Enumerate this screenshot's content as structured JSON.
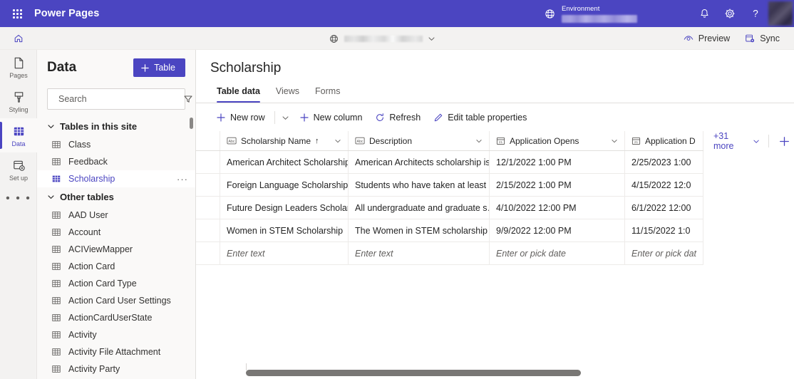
{
  "topbar": {
    "waffle_label": "App launcher",
    "brand": "Power Pages",
    "environment_label": "Environment",
    "environment_value": "",
    "notifications_label": "Notifications",
    "settings_label": "Settings",
    "help_label": "Help",
    "account_label": "Account manager"
  },
  "subbar": {
    "home_label": "Home",
    "site_name": "",
    "site_chevron": "chevron-down",
    "preview_label": "Preview",
    "sync_label": "Sync"
  },
  "rail": {
    "items": [
      {
        "label": "Pages",
        "icon": "page-icon",
        "active": false
      },
      {
        "label": "Styling",
        "icon": "brush-icon",
        "active": false
      },
      {
        "label": "Data",
        "icon": "data-icon",
        "active": true
      },
      {
        "label": "Set up",
        "icon": "setup-icon",
        "active": false
      }
    ],
    "more_label": "• • •"
  },
  "panel": {
    "title": "Data",
    "add_table_label": "Table",
    "search_placeholder": "Search",
    "search_value": "",
    "filter_label": "Filter",
    "groups": [
      {
        "label": "Tables in this site",
        "expanded": true,
        "items": [
          {
            "label": "Class",
            "selected": false
          },
          {
            "label": "Feedback",
            "selected": false
          },
          {
            "label": "Scholarship",
            "selected": true,
            "overflow": "···"
          }
        ]
      },
      {
        "label": "Other tables",
        "expanded": true,
        "items": [
          {
            "label": "AAD User",
            "selected": false
          },
          {
            "label": "Account",
            "selected": false
          },
          {
            "label": "ACIViewMapper",
            "selected": false
          },
          {
            "label": "Action Card",
            "selected": false
          },
          {
            "label": "Action Card Type",
            "selected": false
          },
          {
            "label": "Action Card User Settings",
            "selected": false
          },
          {
            "label": "ActionCardUserState",
            "selected": false
          },
          {
            "label": "Activity",
            "selected": false
          },
          {
            "label": "Activity File Attachment",
            "selected": false
          },
          {
            "label": "Activity Party",
            "selected": false
          }
        ]
      }
    ]
  },
  "main": {
    "title": "Scholarship",
    "tabs": [
      {
        "label": "Table data",
        "active": true
      },
      {
        "label": "Views",
        "active": false
      },
      {
        "label": "Forms",
        "active": false
      }
    ],
    "commands": [
      {
        "label": "New row",
        "icon": "plus-icon"
      },
      {
        "label": "New column",
        "icon": "plus-icon"
      },
      {
        "label": "Refresh",
        "icon": "refresh-icon"
      },
      {
        "label": "Edit table properties",
        "icon": "pencil-icon"
      }
    ],
    "new_row_caret": "chevron-down"
  },
  "grid": {
    "columns": [
      {
        "label": "Scholarship Name",
        "type_icon": "abc-icon",
        "sorted": true,
        "sort_dir": "↑"
      },
      {
        "label": "Description",
        "type_icon": "abc-icon",
        "sorted": false,
        "sort_dir": ""
      },
      {
        "label": "Application Opens",
        "type_icon": "calendar-icon",
        "sorted": false,
        "sort_dir": ""
      },
      {
        "label": "Application D",
        "type_icon": "calendar-icon",
        "sorted": false,
        "sort_dir": ""
      }
    ],
    "more_columns_label": "+31 more",
    "add_column_label": "Add column",
    "rows": [
      {
        "name": "American Architect Scholarship",
        "description": "American Architects scholarship is…",
        "opens": "12/1/2022 1:00 PM",
        "due": "2/25/2023 1:00"
      },
      {
        "name": "Foreign Language Scholarship",
        "description": "Students who have taken at least …",
        "opens": "2/15/2022 1:00 PM",
        "due": "4/15/2022 12:0"
      },
      {
        "name": "Future Design Leaders Scholarship",
        "description": "All undergraduate and graduate s…",
        "opens": "4/10/2022 12:00 PM",
        "due": "6/1/2022 12:00"
      },
      {
        "name": "Women in STEM Scholarship",
        "description": "The Women in STEM scholarship i…",
        "opens": "9/9/2022 12:00 PM",
        "due": "11/15/2022 1:0"
      }
    ],
    "new_row": {
      "name_placeholder": "Enter text",
      "description_placeholder": "Enter text",
      "opens_placeholder": "Enter or pick date",
      "due_placeholder": "Enter or pick dat"
    }
  },
  "colors": {
    "brand_purple": "#4B45C1",
    "subbar_bg": "#F3F2F1",
    "panel_bg": "#FAF9F8",
    "text_primary": "#242424",
    "text_secondary": "#605E5C",
    "border": "#E1DFDD"
  }
}
